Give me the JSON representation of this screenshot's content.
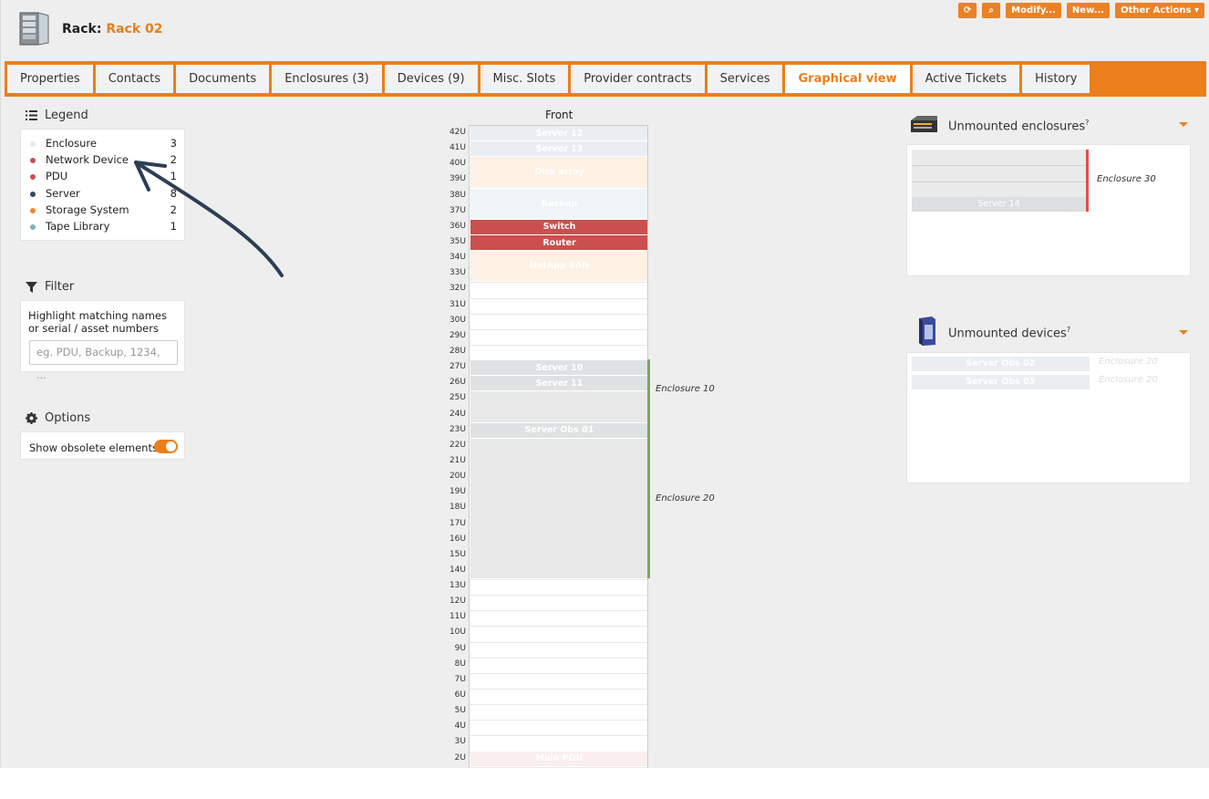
{
  "header": {
    "rack_label": "Rack:",
    "rack_name": "Rack 02",
    "actions": {
      "refresh": "⟳",
      "search": "⌕",
      "modify": "Modify...",
      "new": "New...",
      "other": "Other Actions ▾"
    }
  },
  "tabs": [
    "Properties",
    "Contacts",
    "Documents",
    "Enclosures (3)",
    "Devices (9)",
    "Misc. Slots",
    "Provider contracts",
    "Services",
    "Graphical view",
    "Active Tickets",
    "History"
  ],
  "active_tab": "Graphical view",
  "legend": {
    "title": "Legend",
    "items": [
      {
        "label": "Enclosure",
        "count": "3",
        "color": "#e8e8e8"
      },
      {
        "label": "Network Device",
        "count": "2",
        "color": "#c9504f"
      },
      {
        "label": "PDU",
        "count": "1",
        "color": "#c9504f"
      },
      {
        "label": "Server",
        "count": "8",
        "color": "#2f4b6b"
      },
      {
        "label": "Storage System",
        "count": "2",
        "color": "#ef8a2f"
      },
      {
        "label": "Tape Library",
        "count": "1",
        "color": "#7fb0c4"
      }
    ]
  },
  "filter": {
    "title": "Filter",
    "help": "Highlight matching names or serial / asset numbers",
    "placeholder": "eg. PDU, Backup, 1234, ..."
  },
  "options": {
    "title": "Options",
    "obsolete_label": "Show obsolete elements",
    "obsolete_hint": "?",
    "obsolete_enabled": true
  },
  "rack": {
    "front_label": "Front",
    "units": [
      "42U",
      "41U",
      "40U",
      "39U",
      "38U",
      "37U",
      "36U",
      "35U",
      "34U",
      "33U",
      "32U",
      "31U",
      "30U",
      "29U",
      "28U",
      "27U",
      "26U",
      "25U",
      "24U",
      "23U",
      "22U",
      "21U",
      "20U",
      "19U",
      "18U",
      "17U",
      "16U",
      "15U",
      "14U",
      "13U",
      "12U",
      "11U",
      "10U",
      "9U",
      "8U",
      "7U",
      "6U",
      "5U",
      "4U",
      "3U",
      "2U"
    ],
    "slots": [
      {
        "name": "Server 12",
        "top_u": 42,
        "height_u": 1,
        "color": "#eaeef2"
      },
      {
        "name": "Server 13",
        "top_u": 41,
        "height_u": 1,
        "color": "#eaeef2"
      },
      {
        "name": "Disk array",
        "top_u": 40,
        "height_u": 2,
        "color": "#fdf1e4"
      },
      {
        "name": "Backup",
        "top_u": 38,
        "height_u": 2,
        "color": "#eff5f7"
      },
      {
        "name": "Switch",
        "top_u": 36,
        "height_u": 1,
        "color": "#c9504f"
      },
      {
        "name": "Router",
        "top_u": 35,
        "height_u": 1,
        "color": "#c9504f"
      },
      {
        "name": "NetApp SAN",
        "top_u": 34,
        "height_u": 2,
        "color": "#fdf1e4"
      },
      {
        "name": "Server 10",
        "top_u": 27,
        "height_u": 1,
        "color": "#dfe1e3"
      },
      {
        "name": "Server 11",
        "top_u": 26,
        "height_u": 1,
        "color": "#dfe1e3"
      },
      {
        "name": "",
        "top_u": 25,
        "height_u": 2,
        "color": "#e8e8e8"
      },
      {
        "name": "Server Obs 01",
        "top_u": 23,
        "height_u": 1,
        "color": "#dfe1e3"
      },
      {
        "name": "",
        "top_u": 22,
        "height_u": 9,
        "color": "#e8e8e8"
      },
      {
        "name": "Main PDU",
        "top_u": 2,
        "height_u": 1,
        "color": "#fbeeee"
      }
    ],
    "enclosures": [
      {
        "name": "Enclosure 10",
        "top_u": 27,
        "height_u": 4
      },
      {
        "name": "Enclosure 20",
        "top_u": 23,
        "height_u": 10
      }
    ]
  },
  "unmounted_enclosures": {
    "title": "Unmounted enclosures",
    "hint": "?",
    "items": [
      {
        "name": "Enclosure 30",
        "device": "Server 14"
      }
    ]
  },
  "unmounted_devices": {
    "title": "Unmounted devices",
    "hint": "?",
    "items": [
      {
        "name": "Server Obs 02",
        "enclosure": "Enclosure 20"
      },
      {
        "name": "Server Obs 03",
        "enclosure": "Enclosure 20"
      }
    ]
  }
}
